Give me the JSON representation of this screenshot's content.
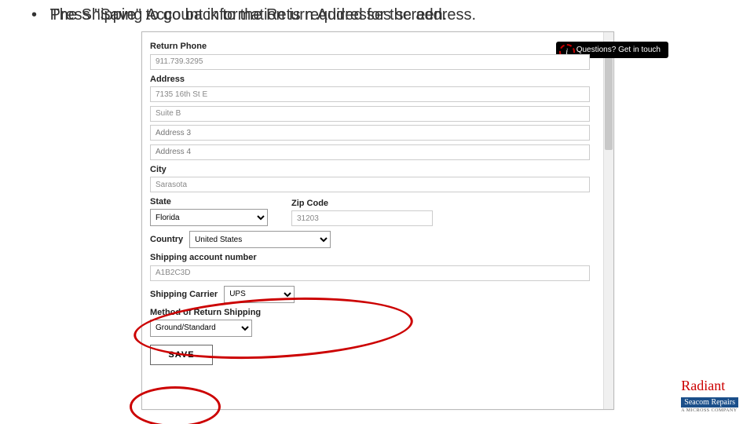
{
  "bullet_text": "Press \"Save\" to go back to the Return Addresses screen.",
  "overlay_text": "The Shipping Account information is required for the address.",
  "questions_badge": "Questions? Get in touch",
  "form": {
    "return_phone": {
      "label": "Return Phone",
      "value": "911.739.3295"
    },
    "address": {
      "label": "Address",
      "line1": "7135 16th St E",
      "line2": "Suite B",
      "line3": "Address 3",
      "line4": "Address 4"
    },
    "city": {
      "label": "City",
      "value": "Sarasota"
    },
    "state": {
      "label": "State",
      "value": "Florida"
    },
    "zip": {
      "label": "Zip Code",
      "value": "31203"
    },
    "country": {
      "label": "Country",
      "value": "United States"
    },
    "ship_acct": {
      "label": "Shipping account number",
      "value": "A1B2C3D"
    },
    "carrier": {
      "label": "Shipping Carrier",
      "value": "UPS"
    },
    "method": {
      "label": "Method of Return Shipping",
      "value": "Ground/Standard"
    },
    "save": "SAVE"
  },
  "logo": {
    "line1": "Radiant",
    "line2": "Seacom Repairs",
    "line3": "A MICROSS COMPANY"
  }
}
